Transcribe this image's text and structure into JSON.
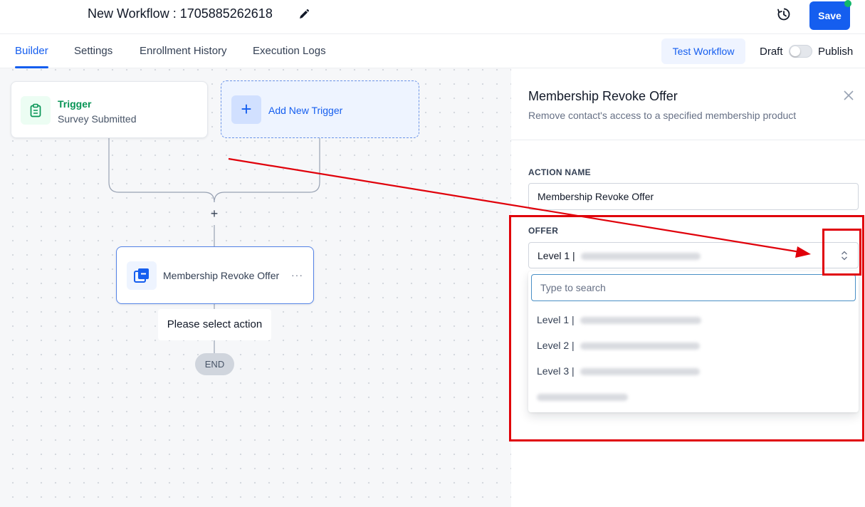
{
  "header": {
    "workflow_title": "New Workflow : 1705885262618",
    "save_label": "Save"
  },
  "tabs": [
    {
      "label": "Builder",
      "active": true
    },
    {
      "label": "Settings",
      "active": false
    },
    {
      "label": "Enrollment History",
      "active": false
    },
    {
      "label": "Execution Logs",
      "active": false
    }
  ],
  "toolbar": {
    "test_workflow_label": "Test Workflow",
    "draft_label": "Draft",
    "publish_label": "Publish",
    "published": false
  },
  "canvas": {
    "trigger": {
      "title": "Trigger",
      "subtitle": "Survey Submitted"
    },
    "add_trigger_label": "Add New Trigger",
    "add_icon": "+",
    "action": {
      "label": "Membership Revoke Offer",
      "more_icon": "···"
    },
    "tooltip": "Please select action",
    "end_label": "END"
  },
  "panel": {
    "title": "Membership Revoke Offer",
    "subtitle": "Remove contact's access to a specified membership product",
    "action_name_label": "ACTION NAME",
    "action_name_value": "Membership Revoke Offer",
    "offer_label": "OFFER",
    "offer_selected": "Level 1 |",
    "search_placeholder": "Type to search",
    "options": [
      {
        "label": "Level 1 |"
      },
      {
        "label": "Level 2 |"
      },
      {
        "label": "Level 3 |"
      },
      {
        "label": ""
      }
    ]
  },
  "colors": {
    "primary": "#155eef",
    "trigger_green": "#079455",
    "annotation_red": "#e0000a",
    "status_dot": "#12b76a"
  }
}
